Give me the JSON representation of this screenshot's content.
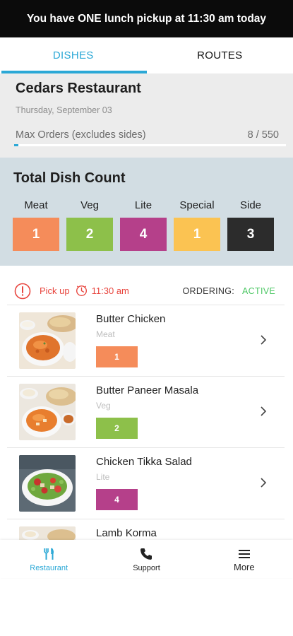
{
  "banner": {
    "text": "You have ONE lunch pickup at 11:30 am today"
  },
  "tabs": [
    {
      "label": "DISHES",
      "active": true
    },
    {
      "label": "ROUTES",
      "active": false
    }
  ],
  "restaurant": {
    "name": "Cedars Restaurant",
    "date": "Thursday, September 03",
    "max_orders_label": "Max Orders (excludes sides)",
    "orders_count": "8 / 550",
    "orders_fraction": 0.0145
  },
  "dish_count": {
    "title": "Total Dish Count",
    "categories": [
      {
        "label": "Meat",
        "count": "1",
        "color": "#f58c5a"
      },
      {
        "label": "Veg",
        "count": "2",
        "color": "#8dc04a"
      },
      {
        "label": "Lite",
        "count": "4",
        "color": "#b5408a"
      },
      {
        "label": "Special",
        "count": "1",
        "color": "#fbc352"
      },
      {
        "label": "Side",
        "count": "3",
        "color": "#2c2c2c"
      }
    ]
  },
  "pickup": {
    "label": "Pick up",
    "time": "11:30 am",
    "ordering_label": "ORDERING:",
    "ordering_status": "ACTIVE",
    "status_color": "#4cc764",
    "alert_color": "#e8463f"
  },
  "dishes": [
    {
      "name": "Butter Chicken",
      "type": "Meat",
      "qty": "1",
      "color": "#f58c5a",
      "image": "butter-chicken-image"
    },
    {
      "name": "Butter Paneer Masala",
      "type": "Veg",
      "qty": "2",
      "color": "#8dc04a",
      "image": "butter-paneer-masala-image"
    },
    {
      "name": "Chicken Tikka Salad",
      "type": "Lite",
      "qty": "4",
      "color": "#b5408a",
      "image": "chicken-tikka-salad-image"
    },
    {
      "name": "Lamb Korma",
      "type": "",
      "qty": "",
      "color": "",
      "image": "lamb-korma-image"
    }
  ],
  "bottom_nav": [
    {
      "label": "Restaurant",
      "icon": "fork-knife-icon",
      "active": true
    },
    {
      "label": "Support",
      "icon": "phone-icon",
      "active": false
    },
    {
      "label": "More",
      "icon": "menu-icon",
      "active": false
    }
  ],
  "colors": {
    "accent": "#2ba8d6",
    "banner_bg": "#0b0b0b",
    "dish_count_bg": "#d2dde3"
  }
}
